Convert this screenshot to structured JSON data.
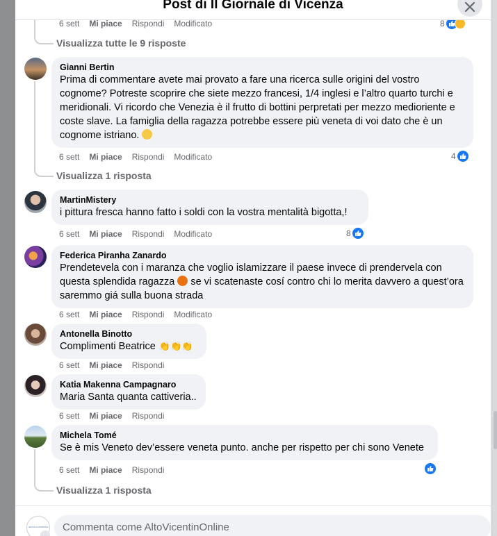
{
  "header": {
    "title": "Post di Il Giornale di Vicenza"
  },
  "top_item": {
    "time": "6 sett",
    "like": "Mi piace",
    "reply": "Rispondi",
    "edited": "Modificato",
    "reactions": "8"
  },
  "view_all_replies": "Visualizza tutte le 9 risposte",
  "comments": [
    {
      "author": "Gianni Bertin",
      "text": "Prima di commentare avete mai provato a fare una ricerca sulle origini del vostro cognome? Potreste scoprire che siete mezzo francesi, 1/4 inglesi e l’altro quarto turchi e meridionali. Vi ricordo che Venezia è il frutto di bottini perpretati per mezzo medioriente e coste slave. La famiglia della ragazza potrebbe essere più veneta di voi dato che è un cognome istriano.",
      "time": "6 sett",
      "like": "Mi piace",
      "reply": "Rispondi",
      "edited": "Modificato",
      "reactions": "4",
      "view_replies": "Visualizza 1 risposta"
    },
    {
      "author": "MartinMistery",
      "text": "i pittura fresca hanno fatto i soldi con la vostra mentalità bigotta,!",
      "time": "6 sett",
      "like": "Mi piace",
      "reply": "Rispondi",
      "edited": "Modificato",
      "reactions": "8"
    },
    {
      "author": "Federica Piranha Zanardo",
      "text_a": "Prendetevela con i maranza che voglio islamizzare il paese invece di prendervela con questa splendida ragazza",
      "text_b": "se vi scatenaste cosí contro chi lo merita davvero a quest’ora saremmo giá sulla buona strada",
      "time": "6 sett",
      "like": "Mi piace",
      "reply": "Rispondi",
      "edited": "Modificato"
    },
    {
      "author": "Antonella Binotto",
      "text": "Complimenti Beatrice",
      "time": "6 sett",
      "like": "Mi piace",
      "reply": "Rispondi"
    },
    {
      "author": "Katia Makenna Campagnaro",
      "text": "Maria Santa quanta cattiveria..",
      "time": "6 sett",
      "like": "Mi piace",
      "reply": "Rispondi"
    },
    {
      "author": "Michela Tomé",
      "text": "Se è mis Veneto dev’essere veneta punto. anche per rispetto per chi sono Venete",
      "time": "6 sett",
      "like": "Mi piace",
      "reply": "Rispondi",
      "view_replies": "Visualizza 1 risposta"
    }
  ],
  "composer": {
    "placeholder": "Commenta come AltoVicentinOnline",
    "avatar_logo": "AltoVicentinOnline"
  },
  "icons": [
    "close-icon",
    "like-icon",
    "haha-icon",
    "grimacing-emoji-icon",
    "angry-emoji-icon",
    "clapping-hands-icon",
    "chevron-down-icon"
  ],
  "colors": {
    "like_blue": "#1877f2",
    "bubble": "#f0f2f5",
    "muted_text": "#65676b"
  }
}
